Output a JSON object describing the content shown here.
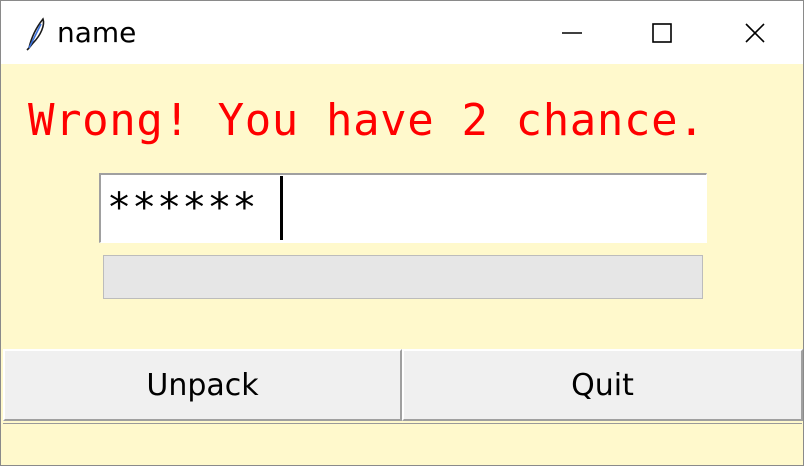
{
  "window": {
    "title": "name",
    "icon": "feather-icon",
    "controls": [
      "minimize-icon",
      "maximize-icon",
      "close-icon"
    ]
  },
  "message": {
    "text": "Wrong! You have 2 chance.",
    "color": "#ff0000"
  },
  "password_entry": {
    "value": "******"
  },
  "progress": {
    "value_percent": 0
  },
  "buttons": {
    "unpack_label": "Unpack",
    "quit_label": "Quit"
  },
  "colors": {
    "background": "#fff9cc",
    "titlebar": "#ffffff",
    "button_face": "#f0f0f0"
  }
}
